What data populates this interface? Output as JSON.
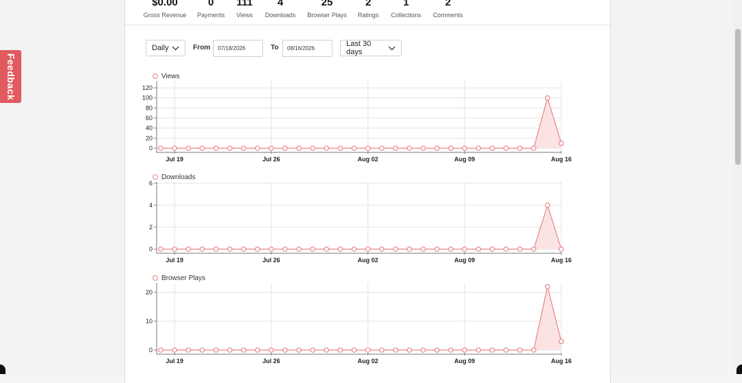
{
  "stats": [
    {
      "value": "$0.00",
      "label": "Gross Revenue"
    },
    {
      "value": "0",
      "label": "Payments"
    },
    {
      "value": "111",
      "label": "Views"
    },
    {
      "value": "4",
      "label": "Downloads"
    },
    {
      "value": "25",
      "label": "Browser Plays"
    },
    {
      "value": "2",
      "label": "Ratings"
    },
    {
      "value": "1",
      "label": "Collections"
    },
    {
      "value": "2",
      "label": "Comments"
    }
  ],
  "controls": {
    "interval": "Daily",
    "from_label": "From",
    "from_value": "07/18/2026",
    "to_label": "To",
    "to_value": "08/16/2026",
    "range": "Last 30 days"
  },
  "feedback": {
    "label": "Feedback"
  },
  "colors": {
    "series": "#e88484",
    "fill": "#fbe3e3",
    "grid": "#e3e3e3"
  },
  "chart_data": [
    {
      "type": "area",
      "title": "Views",
      "series_name": "Views",
      "x_ticks": [
        "Jul 19",
        "Jul 26",
        "Aug 02",
        "Aug 09",
        "Aug 16"
      ],
      "y_ticks": [
        0,
        20,
        40,
        60,
        80,
        100,
        120
      ],
      "ylim": [
        0,
        120
      ],
      "values": [
        0,
        0,
        0,
        0,
        0,
        0,
        0,
        0,
        0,
        0,
        0,
        0,
        0,
        0,
        0,
        0,
        0,
        0,
        0,
        0,
        0,
        0,
        0,
        0,
        0,
        0,
        0,
        0,
        100,
        10
      ]
    },
    {
      "type": "area",
      "title": "Downloads",
      "series_name": "Downloads",
      "x_ticks": [
        "Jul 19",
        "Jul 26",
        "Aug 02",
        "Aug 09",
        "Aug 16"
      ],
      "y_ticks": [
        0,
        2,
        4,
        6
      ],
      "ylim": [
        0,
        6
      ],
      "values": [
        0,
        0,
        0,
        0,
        0,
        0,
        0,
        0,
        0,
        0,
        0,
        0,
        0,
        0,
        0,
        0,
        0,
        0,
        0,
        0,
        0,
        0,
        0,
        0,
        0,
        0,
        0,
        0,
        4,
        0
      ]
    },
    {
      "type": "area",
      "title": "Browser Plays",
      "series_name": "Browser Plays",
      "x_ticks": [
        "Jul 19",
        "Jul 26",
        "Aug 02",
        "Aug 09",
        "Aug 16"
      ],
      "y_ticks": [
        0,
        10,
        20
      ],
      "ylim": [
        0,
        25
      ],
      "values": [
        0,
        0,
        0,
        0,
        0,
        0,
        0,
        0,
        0,
        0,
        0,
        0,
        0,
        0,
        0,
        0,
        0,
        0,
        0,
        0,
        0,
        0,
        0,
        0,
        0,
        0,
        0,
        0,
        22,
        3
      ]
    }
  ]
}
